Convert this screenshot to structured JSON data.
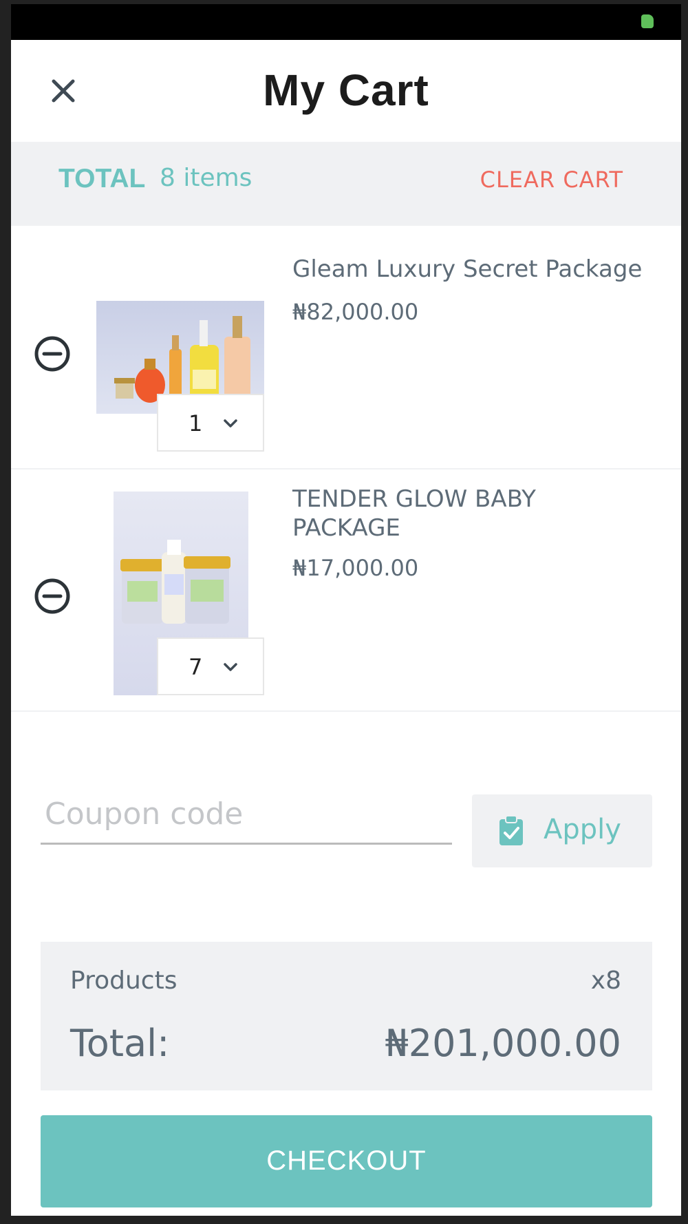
{
  "header": {
    "title": "My Cart",
    "close_icon": "close-icon"
  },
  "total_bar": {
    "label": "TOTAL",
    "items": "8 items",
    "clear_label": "CLEAR CART"
  },
  "cart": {
    "items": [
      {
        "name": "Gleam  Luxury Secret Package",
        "price": "₦82,000.00",
        "quantity": "1",
        "image": "skincare-products-bottles"
      },
      {
        "name": "TENDER GLOW BABY PACKAGE",
        "price": "₦17,000.00",
        "quantity": "7",
        "image": "baby-skincare-jars"
      }
    ]
  },
  "coupon": {
    "placeholder": "Coupon code",
    "apply_label": "Apply"
  },
  "summary": {
    "products_label": "Products",
    "products_count": "x8",
    "total_label": "Total:",
    "total_amount": "₦201,000.00"
  },
  "checkout": {
    "label": "CHECKOUT"
  },
  "colors": {
    "accent": "#6cc3bf",
    "danger": "#ef6a5e",
    "text": "#5d6b77",
    "panel": "#f0f1f3"
  }
}
